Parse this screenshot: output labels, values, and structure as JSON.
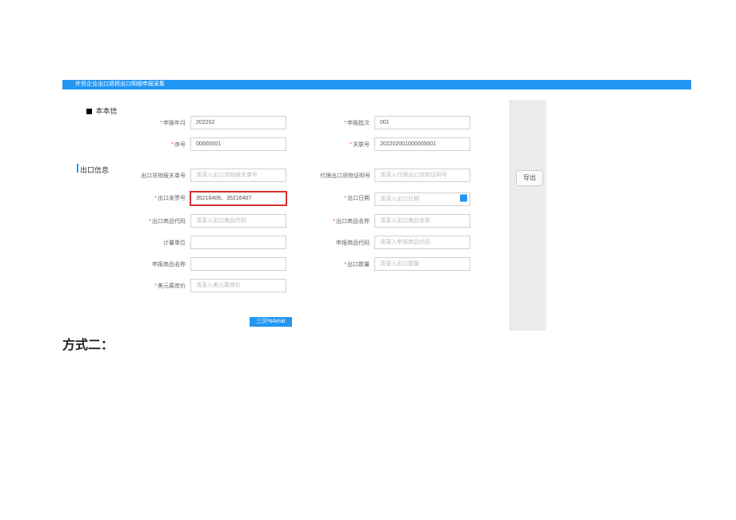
{
  "header": {
    "title": "外贸企业出口退税出口明细申报采集"
  },
  "sections": {
    "basic": "本本信",
    "export": "出口信息"
  },
  "fields": {
    "decl_period": {
      "label": "申报年月",
      "value": "202202"
    },
    "decl_batch": {
      "label": "申报批次",
      "value": "001"
    },
    "seq": {
      "label": "序号",
      "value": "00000001"
    },
    "rel_no": {
      "label": "关联号",
      "value": "202202001000000001"
    },
    "customs_no": {
      "label": "出口货物报关单号",
      "placeholder": "请录入出口货物报关单号"
    },
    "proxy_no": {
      "label": "代理出口货物证明号",
      "placeholder": "请录入代理出口货物证明号"
    },
    "invoice_no": {
      "label": "出口发票号",
      "value": "35216406、35216407"
    },
    "export_date": {
      "label": "出口日期",
      "placeholder": "请录入出口日期"
    },
    "export_code": {
      "label": "出口商品代码",
      "placeholder": "请录入出口商品代码"
    },
    "export_name": {
      "label": "出口商品名称",
      "placeholder": "请录入出口商品名称"
    },
    "unit": {
      "label": "计量单位",
      "placeholder": ""
    },
    "appr_code": {
      "label": "申报商品代码",
      "placeholder": "请录入申报商品代码"
    },
    "appr_name": {
      "label": "申报商品名称",
      "placeholder": ""
    },
    "export_qty": {
      "label": "出口数量",
      "placeholder": "请录入出口数量"
    },
    "usd_fob": {
      "label": "美元离岸价",
      "placeholder": "请录入美元离岸价"
    }
  },
  "buttons": {
    "blue": "三贝%Amat",
    "side_export": "导出"
  },
  "footer": {
    "method2": "方式二："
  }
}
